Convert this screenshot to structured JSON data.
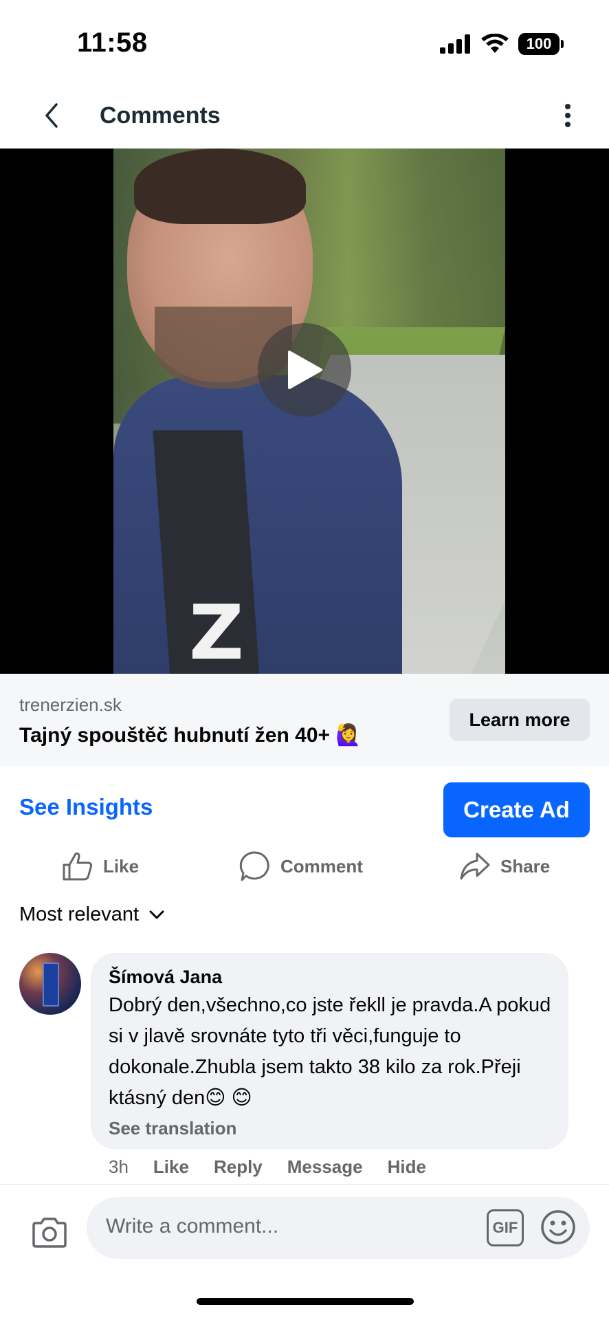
{
  "status_bar": {
    "time": "11:58",
    "battery": "100"
  },
  "nav": {
    "title": "Comments"
  },
  "video": {
    "play_icon": "play-icon"
  },
  "ad": {
    "domain": "trenerzien.sk",
    "headline": "Tajný spouštěč hubnutí žen 40+ 🙋‍♀️",
    "cta": "Learn more"
  },
  "insights": {
    "see_insights": "See Insights",
    "create_ad": "Create Ad"
  },
  "actions": {
    "like": "Like",
    "comment": "Comment",
    "share": "Share"
  },
  "sort": {
    "label": "Most relevant"
  },
  "comment": {
    "author": "Šímová Jana",
    "text": "Dobrý den,všechno,co jste řekll je pravda.A pokud si v jlavě srovnáte tyto tři věci,funguje to dokonale.Zhubla jsem takto 38 kilo za rok.Přeji ktásný den😊 😊",
    "see_translation": "See translation",
    "time": "3h",
    "like": "Like",
    "reply": "Reply",
    "message": "Message",
    "hide": "Hide"
  },
  "composer": {
    "placeholder": "Write a comment...",
    "gif": "GIF"
  },
  "colors": {
    "accent": "#0866ff",
    "secondary_text": "#65676b",
    "bubble_bg": "#f0f2f5"
  }
}
